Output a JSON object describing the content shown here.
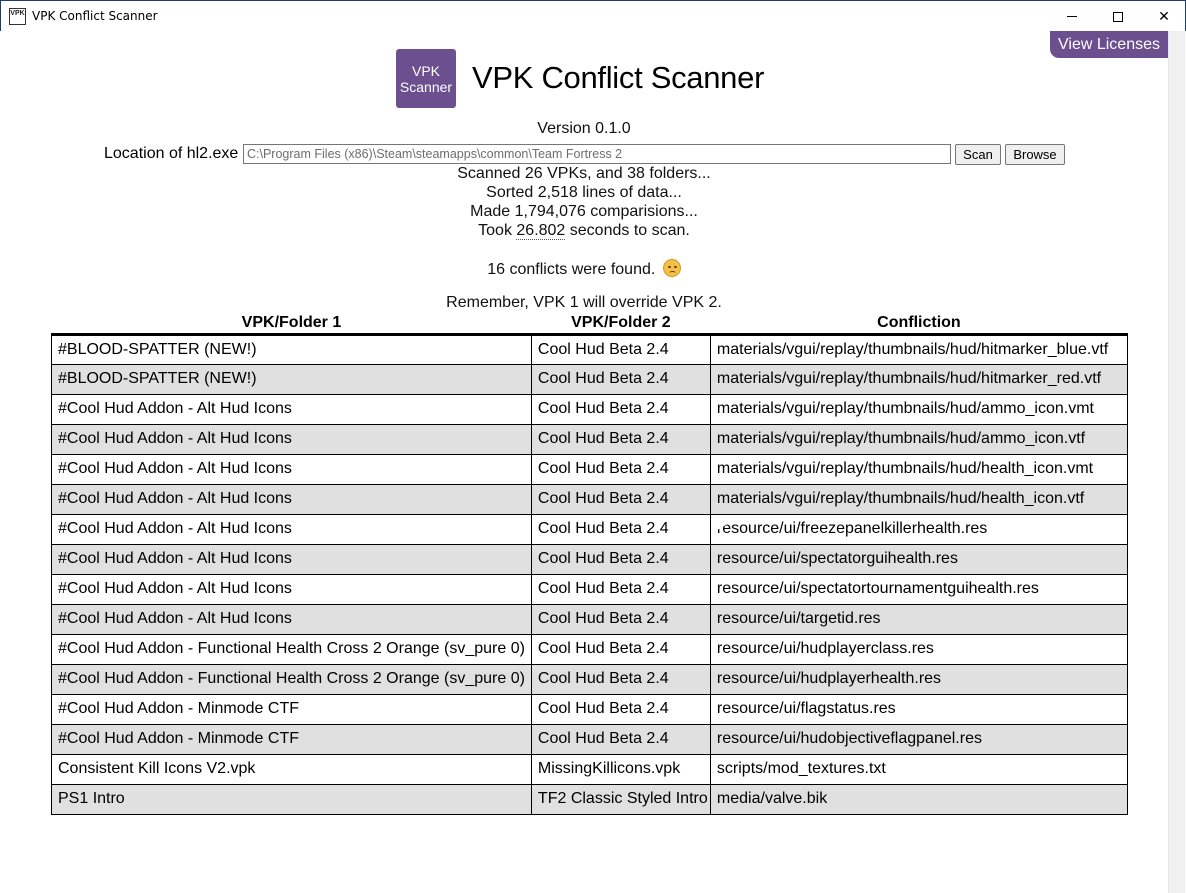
{
  "window": {
    "title": "VPK Conflict Scanner",
    "icon_text": "VPK",
    "minimize_icon": "minimize-icon",
    "maximize_icon": "maximize-icon",
    "close_icon": "close-icon",
    "close_glyph": "✕"
  },
  "header": {
    "licenses_label": "View Licenses",
    "logo_line1": "VPK",
    "logo_line2": "Scanner",
    "app_title": "VPK Conflict Scanner",
    "version": "Version 0.1.0",
    "accent_color": "#6b4f8e"
  },
  "location": {
    "label": "Location of hl2.exe",
    "value": "C:\\Program Files (x86)\\Steam\\steamapps\\common\\Team Fortress 2",
    "scan_label": "Scan",
    "browse_label": "Browse"
  },
  "status": {
    "scanned": "Scanned 26 VPKs, and 38 folders...",
    "sorted": "Sorted 2,518 lines of data...",
    "comparisons": "Made 1,794,076 comparisions...",
    "took_prefix": "Took ",
    "took_seconds": "26.802",
    "took_suffix": " seconds to scan.",
    "conflicts": "16 conflicts were found.",
    "conflicts_icon": "sad-face-icon",
    "remember": "Remember, VPK 1 will override VPK 2."
  },
  "table": {
    "headers": [
      "VPK/Folder 1",
      "VPK/Folder 2",
      "Confliction"
    ],
    "rows": [
      [
        "#BLOOD-SPATTER (NEW!)",
        "Cool Hud Beta 2.4",
        "materials/vgui/replay/thumbnails/hud/hitmarker_blue.vtf"
      ],
      [
        "#BLOOD-SPATTER (NEW!)",
        "Cool Hud Beta 2.4",
        "materials/vgui/replay/thumbnails/hud/hitmarker_red.vtf"
      ],
      [
        "#Cool Hud Addon - Alt Hud Icons",
        "Cool Hud Beta 2.4",
        "materials/vgui/replay/thumbnails/hud/ammo_icon.vmt"
      ],
      [
        "#Cool Hud Addon - Alt Hud Icons",
        "Cool Hud Beta 2.4",
        "materials/vgui/replay/thumbnails/hud/ammo_icon.vtf"
      ],
      [
        "#Cool Hud Addon - Alt Hud Icons",
        "Cool Hud Beta 2.4",
        "materials/vgui/replay/thumbnails/hud/health_icon.vmt"
      ],
      [
        "#Cool Hud Addon - Alt Hud Icons",
        "Cool Hud Beta 2.4",
        "materials/vgui/replay/thumbnails/hud/health_icon.vtf"
      ],
      [
        "#Cool Hud Addon - Alt Hud Icons",
        "Cool Hud Beta 2.4",
        "resource/ui/freezepanelkillerhealth.res"
      ],
      [
        "#Cool Hud Addon - Alt Hud Icons",
        "Cool Hud Beta 2.4",
        "resource/ui/spectatorguihealth.res"
      ],
      [
        "#Cool Hud Addon - Alt Hud Icons",
        "Cool Hud Beta 2.4",
        "resource/ui/spectatortournamentguihealth.res"
      ],
      [
        "#Cool Hud Addon - Alt Hud Icons",
        "Cool Hud Beta 2.4",
        "resource/ui/targetid.res"
      ],
      [
        "#Cool Hud Addon - Functional Health Cross 2 Orange (sv_pure 0)",
        "Cool Hud Beta 2.4",
        "resource/ui/hudplayerclass.res"
      ],
      [
        "#Cool Hud Addon - Functional Health Cross 2 Orange (sv_pure 0)",
        "Cool Hud Beta 2.4",
        "resource/ui/hudplayerhealth.res"
      ],
      [
        "#Cool Hud Addon - Minmode CTF",
        "Cool Hud Beta 2.4",
        "resource/ui/flagstatus.res"
      ],
      [
        "#Cool Hud Addon - Minmode CTF",
        "Cool Hud Beta 2.4",
        "resource/ui/hudobjectiveflagpanel.res"
      ],
      [
        "Consistent Kill Icons V2.vpk",
        "MissingKillicons.vpk",
        "scripts/mod_textures.txt"
      ],
      [
        "PS1 Intro",
        "TF2 Classic Styled Intro",
        "media/valve.bik"
      ]
    ]
  }
}
